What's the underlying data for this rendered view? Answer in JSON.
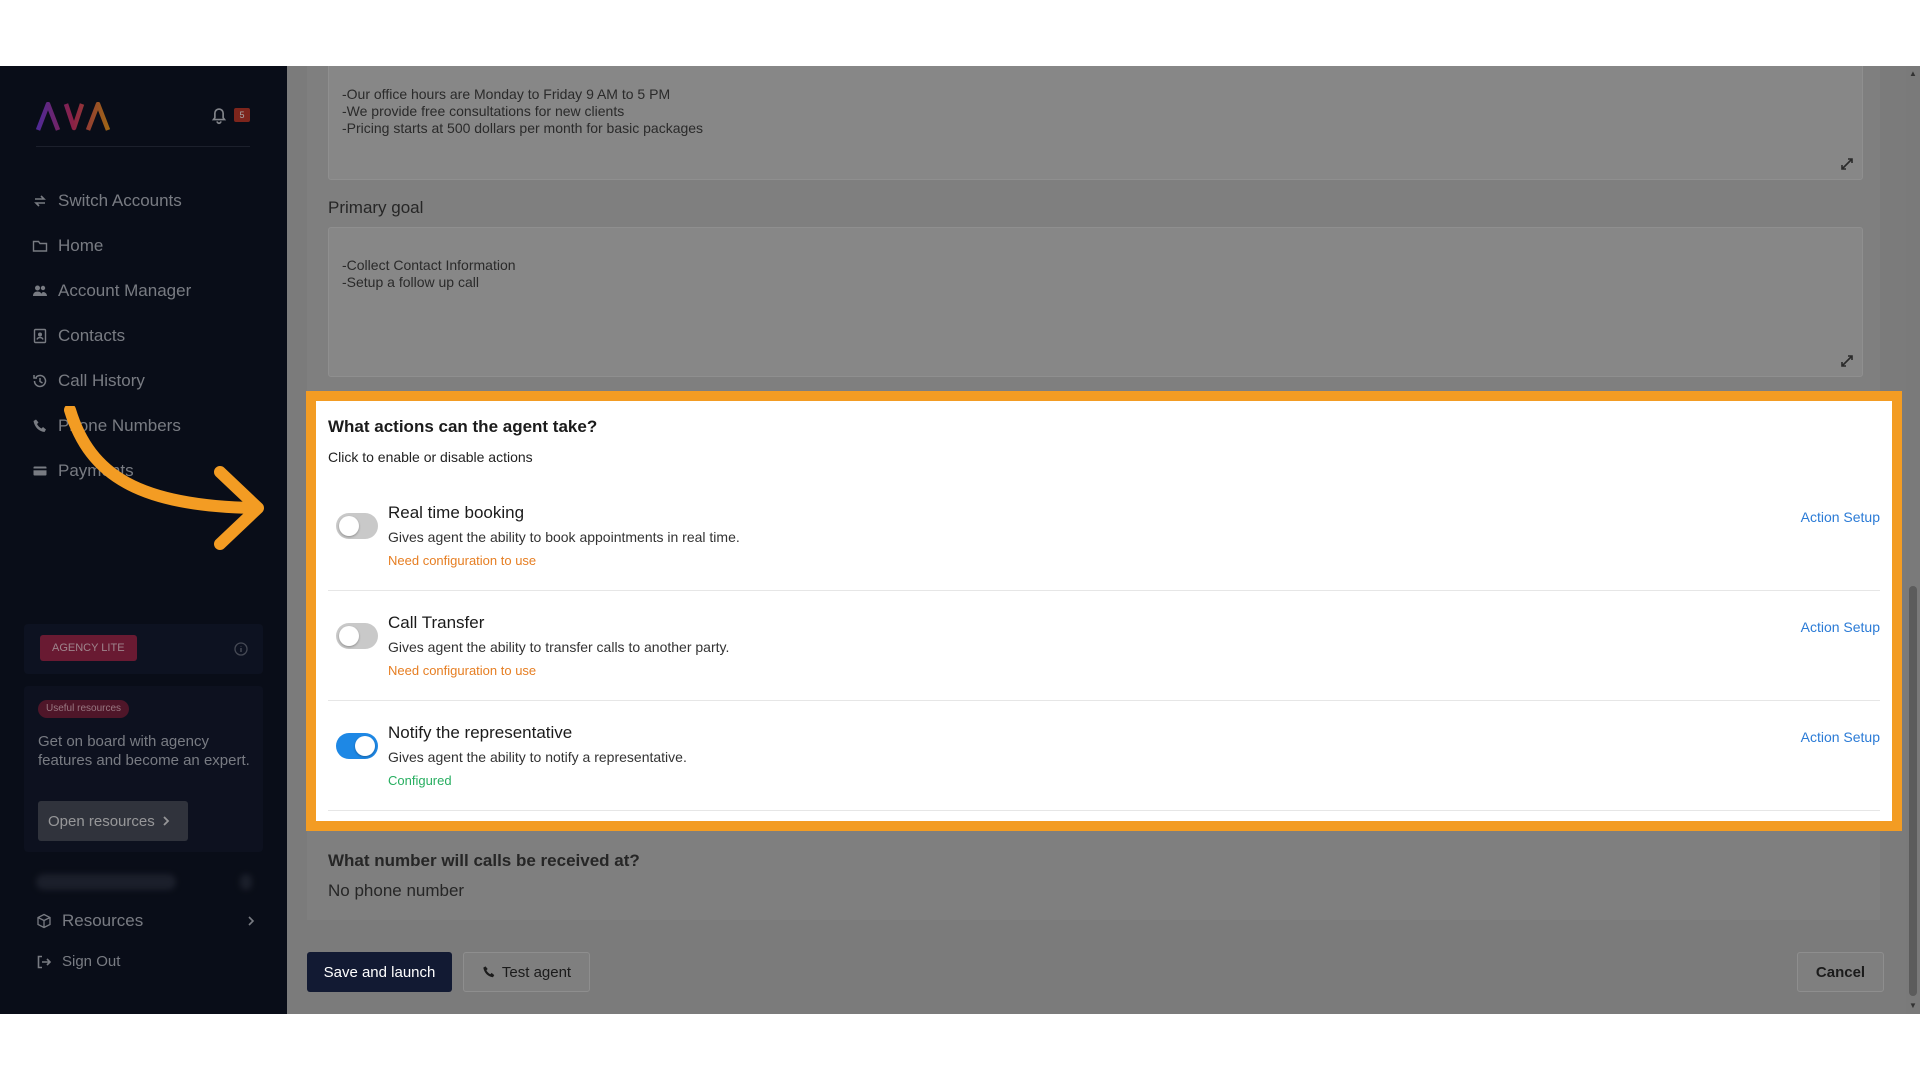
{
  "sidebar": {
    "brand": "AVA",
    "notification_count": "5",
    "nav": [
      {
        "label": "Switch Accounts",
        "icon": "switch-icon"
      },
      {
        "label": "Home",
        "icon": "folder-icon"
      },
      {
        "label": "Account Manager",
        "icon": "users-icon"
      },
      {
        "label": "Contacts",
        "icon": "contacts-icon"
      },
      {
        "label": "Call History",
        "icon": "history-icon"
      },
      {
        "label": "Phone Numbers",
        "icon": "phone-icon"
      },
      {
        "label": "Payments",
        "icon": "card-icon"
      }
    ],
    "agency_badge": "AGENCY LITE",
    "resources_card": {
      "badge": "Useful resources",
      "text": "Get on board with agency features and become an expert.",
      "button": "Open resources"
    },
    "resources": "Resources",
    "sign_out": "Sign Out"
  },
  "main": {
    "info_box_text": "-Our office hours are Monday to Friday 9 AM to 5 PM\n-We provide free consultations for new clients\n-Pricing starts at 500 dollars per month for basic packages",
    "primary_goal_label": "Primary goal",
    "primary_goal_text": "-Collect Contact Information\n-Setup a follow up call",
    "actions": {
      "title": "What actions can the agent take?",
      "subtitle": "Click to enable or disable actions",
      "items": [
        {
          "title": "Real time booking",
          "desc": "Gives agent the ability to book appointments in real time.",
          "status": "Need configuration to use",
          "setup": "Action Setup",
          "enabled": false
        },
        {
          "title": "Call Transfer",
          "desc": "Gives agent the ability to transfer calls to another party.",
          "status": "Need configuration to use",
          "setup": "Action Setup",
          "enabled": false
        },
        {
          "title": "Notify the representative",
          "desc": "Gives agent the ability to notify a representative.",
          "status": "Configured",
          "setup": "Action Setup",
          "enabled": true
        }
      ]
    },
    "phone_label": "What number will calls be received at?",
    "phone_value": "No phone number"
  },
  "footer": {
    "save": "Save and launch",
    "test": "Test agent",
    "cancel": "Cancel"
  },
  "colors": {
    "highlight": "#f39c23",
    "toggle_on": "#1e88e5",
    "warning": "#e67e22",
    "success": "#27ae60",
    "link": "#2b7bd6"
  }
}
